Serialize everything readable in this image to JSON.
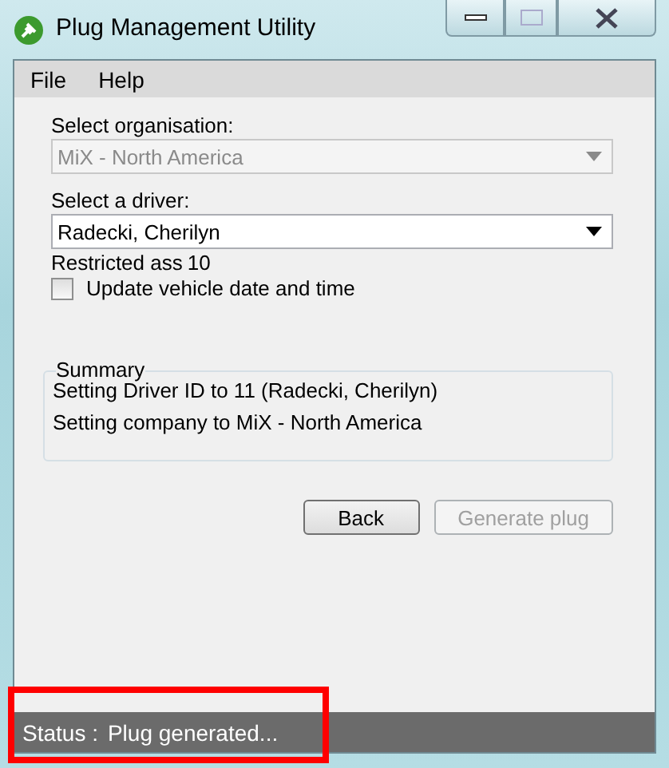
{
  "window": {
    "title": "Plug Management Utility"
  },
  "menu": [
    "File",
    "Help"
  ],
  "organisation": {
    "label": "Select organisation:",
    "value": "MiX - North America",
    "disabled": true
  },
  "driver": {
    "label": "Select a driver:",
    "value": "Radecki, Cherilyn",
    "disabled": false
  },
  "restricted": {
    "label": "Restricted ass",
    "value": "10"
  },
  "update_time": {
    "label": "Update vehicle date and time",
    "checked": false
  },
  "summary": {
    "title": "Summary",
    "lines": [
      "Setting Driver ID to 11 (Radecki, Cherilyn)",
      "Setting company to MiX - North America"
    ]
  },
  "buttons": [
    {
      "label": "Back",
      "disabled": false
    },
    {
      "label": "Generate plug",
      "disabled": true
    }
  ],
  "status_bar": {
    "label": "Status :",
    "text": "Plug generated...",
    "highlighted": true
  }
}
